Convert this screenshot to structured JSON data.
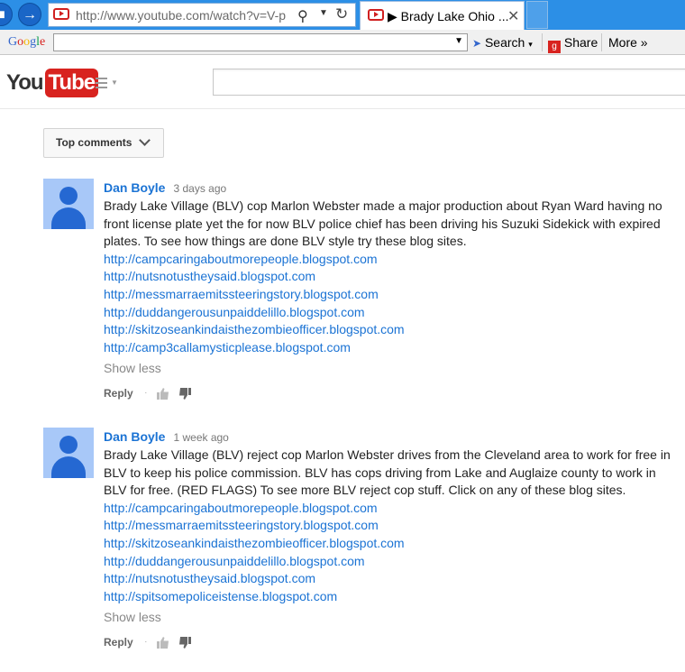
{
  "browser": {
    "url": "http://www.youtube.com/watch?v=V-p",
    "tab_title": "▶ Brady Lake Ohio ...",
    "tab_close": "✕"
  },
  "google_toolbar": {
    "logo": "Google",
    "search_label": "Search",
    "share_label": "Share",
    "more_label": "More »"
  },
  "youtube": {
    "logo_you": "You",
    "logo_tube": "Tube"
  },
  "comments_sort": {
    "label": "Top comments"
  },
  "comments": [
    {
      "author": "Dan Boyle",
      "time": "3 days ago",
      "text": "Brady Lake Village (BLV) cop Marlon Webster made a major production about Ryan Ward having no front license plate yet the for now BLV police chief has been driving his Suzuki Sidekick with expired plates. To see how things are done BLV style try these blog sites.",
      "links": [
        "http://campcaringaboutmorepeople.blogspot.com",
        "http://nutsnotustheysaid.blogspot.com",
        "http://messmarraemitssteeringstory.blogspot.com",
        "http://duddangerousunpaiddelillo.blogspot.com",
        "http://skitzoseankindaisthezombieofficer.blogspot.com",
        "http://camp3callamysticplease.blogspot.com"
      ],
      "show_less": "Show less",
      "reply": "Reply"
    },
    {
      "author": "Dan Boyle",
      "time": "1 week ago",
      "text": "Brady Lake Village (BLV)  reject cop Marlon Webster drives from the Cleveland area to work for free in BLV to keep his police commission. BLV has cops driving from Lake and Auglaize county to work in BLV for free. (RED FLAGS) To see more BLV reject cop stuff. Click on any of these blog sites.",
      "links": [
        "http://campcaringaboutmorepeople.blogspot.com",
        "http://messmarraemitssteeringstory.blogspot.com",
        "http://skitzoseankindaisthezombieofficer.blogspot.com",
        "http://duddangerousunpaiddelillo.blogspot.com",
        "http://nutsnotustheysaid.blogspot.com",
        "http://spitsomepoliceistense.blogspot.com"
      ],
      "show_less": "Show less",
      "reply": "Reply"
    }
  ],
  "colors": {
    "link": "#1b73d4",
    "browser_bar": "#2c8fe6",
    "youtube_red": "#d8231f",
    "avatar_bg": "#a8c8f8"
  }
}
